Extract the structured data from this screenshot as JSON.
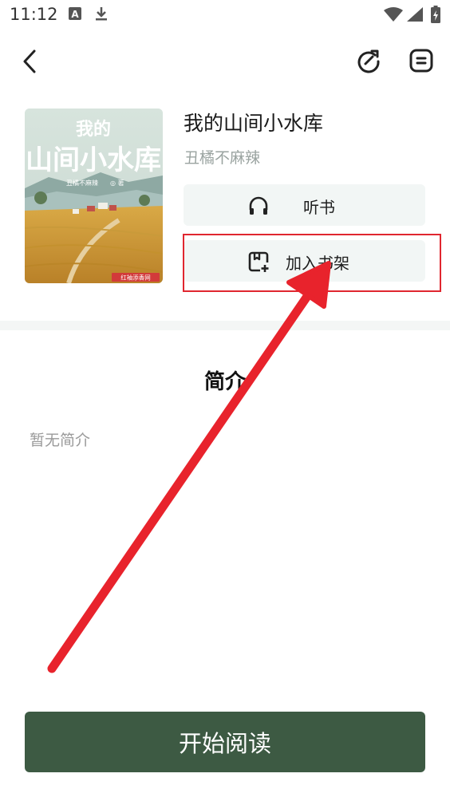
{
  "status_bar": {
    "time": "11:12",
    "icons": [
      "a-notification-icon",
      "download-icon",
      "wifi-icon",
      "signal-icon",
      "battery-icon"
    ]
  },
  "top_bar": {
    "back_icon": "chevron-left-icon",
    "share_icon": "share-refresh-icon",
    "menu_icon": "menu-icon"
  },
  "book": {
    "title": "我的山间小水库",
    "author": "丑橘不麻辣",
    "cover": {
      "title_line1": "我的",
      "title_line2": "山间小水库",
      "author_line": "丑橘不麻辣",
      "author_suffix": "◎ 著",
      "publisher_badge": "红袖添香网"
    }
  },
  "actions": {
    "listen_label": "听书",
    "listen_icon": "headphones-icon",
    "add_shelf_label": "加入书架",
    "add_shelf_icon": "bookshelf-add-icon"
  },
  "intro": {
    "heading": "简介",
    "text": "暂无简介"
  },
  "start_button": {
    "label": "开始阅读"
  },
  "colors": {
    "accent_green": "#3d5a43",
    "annotation_red": "#e0262f",
    "button_bg": "#f2f6f5"
  }
}
